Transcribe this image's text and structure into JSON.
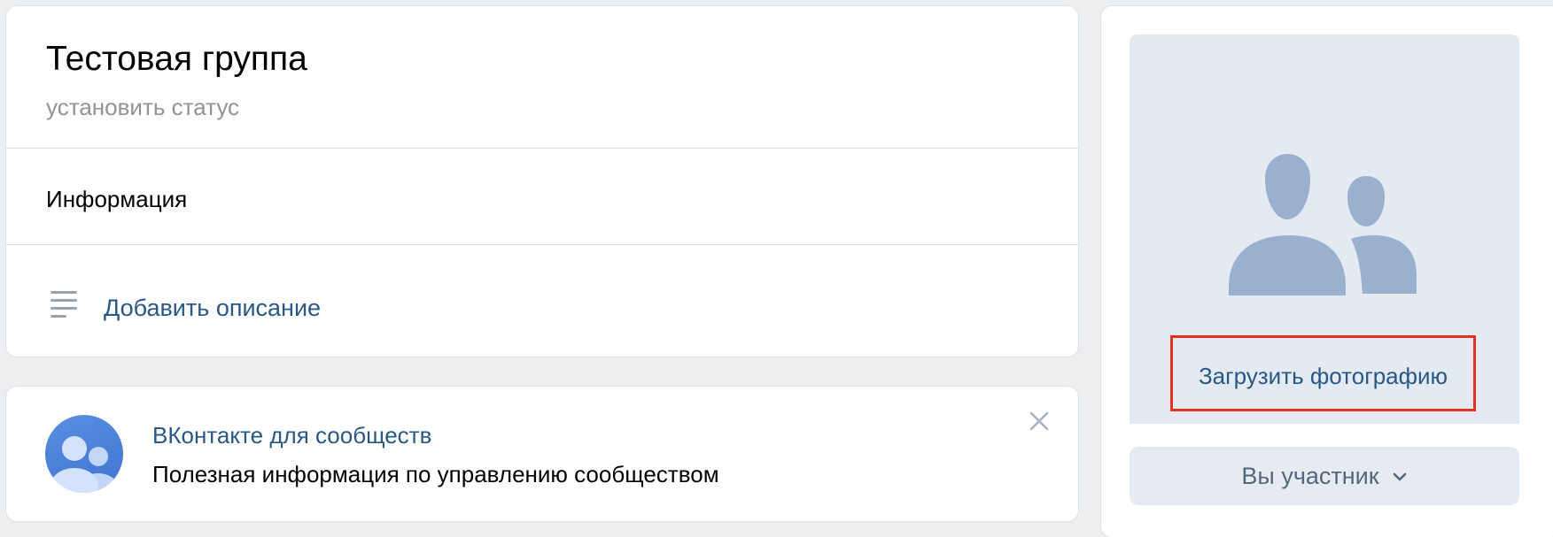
{
  "info_card": {
    "title": "Тестовая группа",
    "status_placeholder": "установить статус",
    "info_label": "Информация",
    "add_description_label": "Добавить описание"
  },
  "promo": {
    "title": "ВКонтакте для сообществ",
    "subtitle": "Полезная информация по управлению сообществом"
  },
  "side": {
    "upload_photo_label": "Загрузить фотографию",
    "member_button_label": "Вы участник"
  },
  "icons": {
    "description": "list-lines-icon",
    "close": "close-icon",
    "placeholder": "group-users-icon",
    "chevron": "chevron-down-icon",
    "promo_avatar": "community-avatar-icon"
  },
  "colors": {
    "link": "#2a5885",
    "muted_text": "#939393",
    "placeholder_bg": "#e4eaf2",
    "placeholder_icon": "#99b0cf",
    "highlight_border": "#e8331c",
    "button_bg": "#e5ebf1",
    "button_text": "#55677d"
  }
}
